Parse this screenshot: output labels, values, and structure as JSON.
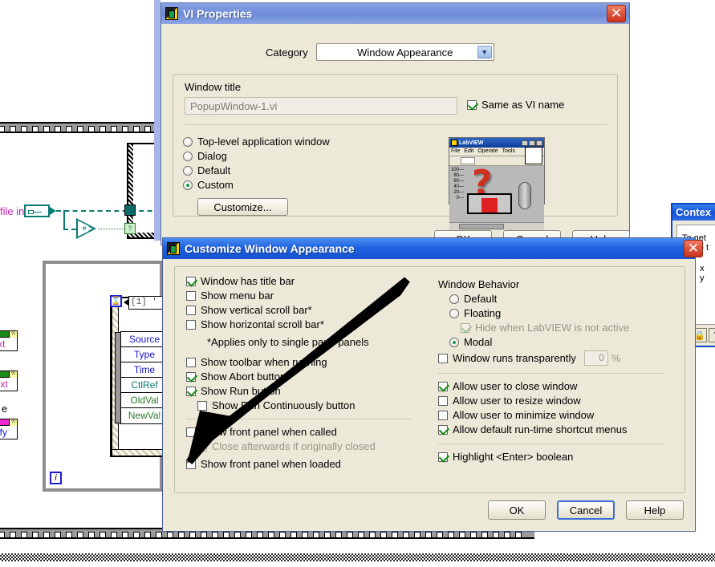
{
  "background": {
    "diagram_labels": {
      "file_in": "file in",
      "case_selector": "[1] '",
      "iteration": "i",
      "prop_text_1": ".Text",
      "prop_text_2": "t.Text",
      "prop_partial": "e",
      "prop_justify": "ustify"
    },
    "event_terminals": [
      "Source",
      "Type",
      "Time",
      "CtlRef",
      "OldVal",
      "NewVal"
    ]
  },
  "context_help": {
    "title": "Contex",
    "line1": "To get",
    "line2": "move t",
    "axis_x": "x",
    "axis_y": "y",
    "buttons": [
      "lock-icon",
      "pin-icon",
      "help-icon"
    ]
  },
  "vi_properties": {
    "title": "VI Properties",
    "close_label": "✕",
    "category_label": "Category",
    "category_value": "Window Appearance",
    "window_title_label": "Window title",
    "window_title_value": "PopupWindow-1.vi",
    "same_as_vi_name": {
      "label": "Same as VI name",
      "checked": true
    },
    "window_type_options": [
      {
        "label": "Top-level application window",
        "selected": false
      },
      {
        "label": "Dialog",
        "selected": false
      },
      {
        "label": "Default",
        "selected": false
      },
      {
        "label": "Custom",
        "selected": true
      }
    ],
    "customize_button": "Customize...",
    "preview": {
      "app_name": "LabVIEW",
      "menus": [
        "File",
        "Edit",
        "Operate",
        "Tools"
      ],
      "scale_ticks": [
        "100",
        "80",
        "60",
        "40",
        "20",
        "0"
      ],
      "question_mark": "?"
    },
    "footer_buttons": [
      "OK",
      "Cancel",
      "Help"
    ]
  },
  "customize_window": {
    "title": "Customize Window Appearance",
    "close_label": "✕",
    "left_column": {
      "items": [
        {
          "label": "Window has title bar",
          "checked": true,
          "disabled": false,
          "indent": 0
        },
        {
          "label": "Show menu bar",
          "checked": false,
          "disabled": false,
          "indent": 0
        },
        {
          "label": "Show vertical scroll bar*",
          "checked": false,
          "disabled": false,
          "indent": 0
        },
        {
          "label": "Show horizontal scroll bar*",
          "checked": false,
          "disabled": false,
          "indent": 0
        }
      ],
      "footnote": "*Applies only to single pane panels",
      "items2": [
        {
          "label": "Show toolbar when running",
          "checked": false,
          "disabled": false,
          "indent": 0
        },
        {
          "label": "Show Abort button",
          "checked": true,
          "disabled": false,
          "indent": 0
        },
        {
          "label": "Show Run button",
          "checked": true,
          "disabled": false,
          "indent": 0
        },
        {
          "label": "Show Run Continuously button",
          "checked": false,
          "disabled": false,
          "indent": 1
        }
      ],
      "items3": [
        {
          "label": "Show front panel when called",
          "checked": false,
          "disabled": false,
          "indent": 0
        },
        {
          "label": "Close afterwards if originally closed",
          "checked": false,
          "disabled": true,
          "indent": 1
        },
        {
          "label": "Show front panel when loaded",
          "checked": false,
          "disabled": false,
          "indent": 0
        }
      ]
    },
    "right_column": {
      "behavior_label": "Window Behavior",
      "behavior_options": [
        {
          "label": "Default",
          "selected": false,
          "indent": 1,
          "type": "radio"
        },
        {
          "label": "Floating",
          "selected": false,
          "indent": 1,
          "type": "radio"
        },
        {
          "label": "Hide when LabVIEW is not active",
          "checked": true,
          "disabled": true,
          "indent": 2,
          "type": "check"
        },
        {
          "label": "Modal",
          "selected": true,
          "indent": 1,
          "type": "radio"
        }
      ],
      "transparency": {
        "label": "Window runs transparently",
        "checked": false,
        "value": "0",
        "unit": "%"
      },
      "permissions": [
        {
          "label": "Allow user to close window",
          "checked": true
        },
        {
          "label": "Allow user to resize window",
          "checked": false
        },
        {
          "label": "Allow user to minimize window",
          "checked": false
        },
        {
          "label": "Allow default run-time shortcut menus",
          "checked": true
        }
      ],
      "highlight": {
        "label": "Highlight <Enter> boolean",
        "checked": true
      }
    },
    "footer_buttons": [
      {
        "label": "OK",
        "focused": false
      },
      {
        "label": "Cancel",
        "focused": true
      },
      {
        "label": "Help",
        "focused": false
      }
    ]
  },
  "colors": {
    "dialog_face": "#ece9d8",
    "titlebar_blue": "#1f62e0",
    "titlebar_lavender": "#7e99df",
    "check_green": "#1a8a1a",
    "wire_teal": "#0a7a73",
    "close_red": "#c8321c"
  }
}
